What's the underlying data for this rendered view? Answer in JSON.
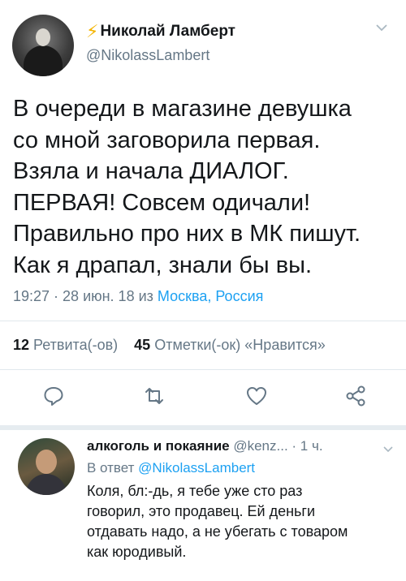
{
  "tweet": {
    "display_name": "Николай Ламберт",
    "handle": "@NikolassLambert",
    "lines": [
      "В очереди в магазине девушка",
      "со мной заговорила первая.",
      "Взяла и начала ДИАЛОГ.",
      "ПЕРВАЯ! Совсем одичали!",
      "Правильно про них в МК пишут.",
      "Как я драпал, знали бы вы."
    ],
    "timestamp": "19:27 · 28 июн. 18 из ",
    "location": "Москва, Россия",
    "retweets_count": "12",
    "retweets_label": "Ретвита(-ов)",
    "likes_count": "45",
    "likes_label": "Отметки(-ок) «Нравится»"
  },
  "reply": {
    "display_name": "алкоголь и покаяние",
    "handle_time": "@kenz...  · 1 ч.",
    "in_reply_to_prefix": "В ответ ",
    "in_reply_to_handle": "@NikolassLambert",
    "lines": [
      "Коля, бл:-дь, я тебе уже сто раз",
      "говорил, это продавец. Ей деньги",
      "отдавать надо, а не убегать с товаром",
      "как юродивый."
    ]
  },
  "icons": [
    "lightning-icon",
    "chevron-down-icon",
    "reply-icon",
    "retweet-icon",
    "like-icon",
    "share-icon"
  ],
  "colors": {
    "accent": "#1da1f2",
    "secondary_text": "#657786",
    "bolt": "#f4b400"
  }
}
